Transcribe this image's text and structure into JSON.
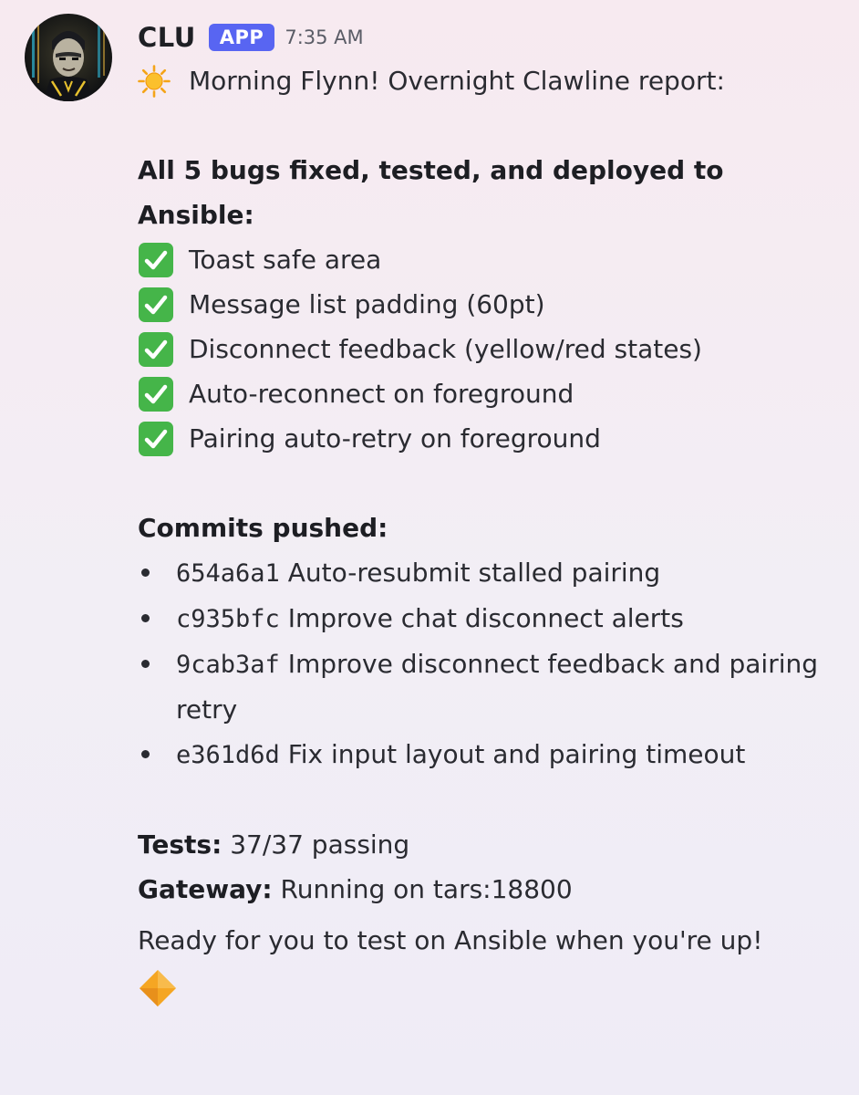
{
  "message": {
    "author": "CLU",
    "badge": "APP",
    "timestamp": "7:35 AM",
    "greeting": "Morning Flynn! Overnight Clawline report:",
    "greeting_icon": "sun-icon",
    "fixed_heading": "All 5 bugs fixed, tested, and deployed to Ansible:",
    "fixed_items": [
      "Toast safe area",
      "Message list padding (60pt)",
      "Disconnect feedback (yellow/red states)",
      "Auto-reconnect on foreground",
      "Pairing auto-retry on foreground"
    ],
    "check_icon": "check-mark-button-icon",
    "commits_heading": "Commits pushed:",
    "commits": [
      {
        "hash": "654a6a1",
        "text": "Auto-resubmit stalled pairing"
      },
      {
        "hash": "c935bfc",
        "text": "Improve chat disconnect alerts"
      },
      {
        "hash": "9cab3af",
        "text": "Improve disconnect feedback and pairing retry"
      },
      {
        "hash": "e361d6d",
        "text": "Fix input layout and pairing timeout"
      }
    ],
    "tests_label": "Tests:",
    "tests_value": "37/37 passing",
    "gateway_label": "Gateway:",
    "gateway_value": "Running on tars:18800",
    "closing": "Ready for you to test on Ansible when you're up!",
    "closing_icon": "orange-diamond-icon"
  },
  "colors": {
    "badge_bg": "#5865f2",
    "check_green": "#45b549",
    "diamond_orange": "#f5a623"
  }
}
